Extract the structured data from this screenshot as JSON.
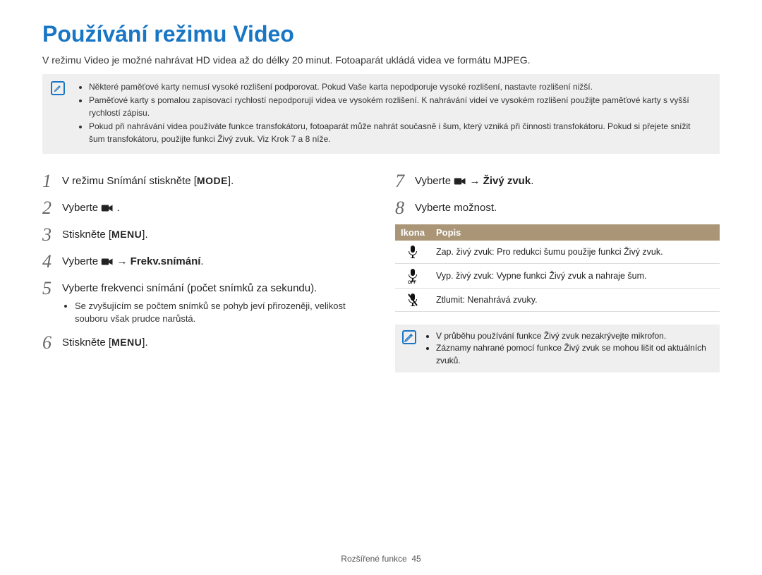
{
  "title": "Používání režimu Video",
  "intro": "V režimu Video je možné nahrávat HD videa až do délky 20 minut. Fotoaparát ukládá videa ve formátu MJPEG.",
  "topnotes": [
    "Některé paměťové karty nemusí vysoké rozlišení podporovat. Pokud Vaše karta nepodporuje vysoké rozlišení, nastavte rozlišení nižší.",
    "Paměťové karty s pomalou zapisovací rychlostí nepodporují videa ve vysokém rozlišení. K nahrávání videí ve vysokém rozlišení použijte paměťové karty s vyšší rychlostí zápisu.",
    "Pokud při nahrávání videa používáte funkce transfokátoru, fotoaparát může nahrát současně i šum, který vzniká při činnosti transfokátoru. Pokud si přejete snížit šum transfokátoru, použijte funkci Živý zvuk. Viz Krok 7 a 8 níže."
  ],
  "steps_left": {
    "s1_pre": "V režimu Snímání stiskněte [",
    "s1_label": "MODE",
    "s1_post": "].",
    "s2": "Vyberte ",
    "s2_post": " .",
    "s3_pre": "Stiskněte [",
    "s3_label": "MENU",
    "s3_post": "].",
    "s4_pre": "Vyberte ",
    "s4_arrow": " → ",
    "s4_bold": "Frekv.snímání",
    "s4_post": ".",
    "s5": "Vyberte frekvenci snímání (počet snímků za sekundu).",
    "s5_note": "Se zvyšujícím se počtem snímků se pohyb jeví přirozeněji, velikost souboru však prudce narůstá.",
    "s6_pre": "Stiskněte [",
    "s6_label": "MENU",
    "s6_post": "]."
  },
  "steps_right": {
    "s7_pre": "Vyberte ",
    "s7_arrow": " → ",
    "s7_bold": "Živý zvuk",
    "s7_post": ".",
    "s8": "Vyberte možnost."
  },
  "table": {
    "h1": "Ikona",
    "h2": "Popis",
    "r1b": "Zap. živý zvuk",
    "r1t": ": Pro redukci šumu použije funkci Živý zvuk.",
    "r2b": "Vyp. živý zvuk",
    "r2t": ": Vypne funkci Živý zvuk a nahraje šum.",
    "r3b": "Ztlumit",
    "r3t": ": Nenahrává zvuky."
  },
  "bottomnotes": [
    "V průběhu používání funkce Živý zvuk nezakrývejte mikrofon.",
    "Záznamy nahrané pomocí funkce Živý zvuk se mohou lišit od aktuálních zvuků."
  ],
  "footer_label": "Rozšířené funkce",
  "footer_page": "45"
}
